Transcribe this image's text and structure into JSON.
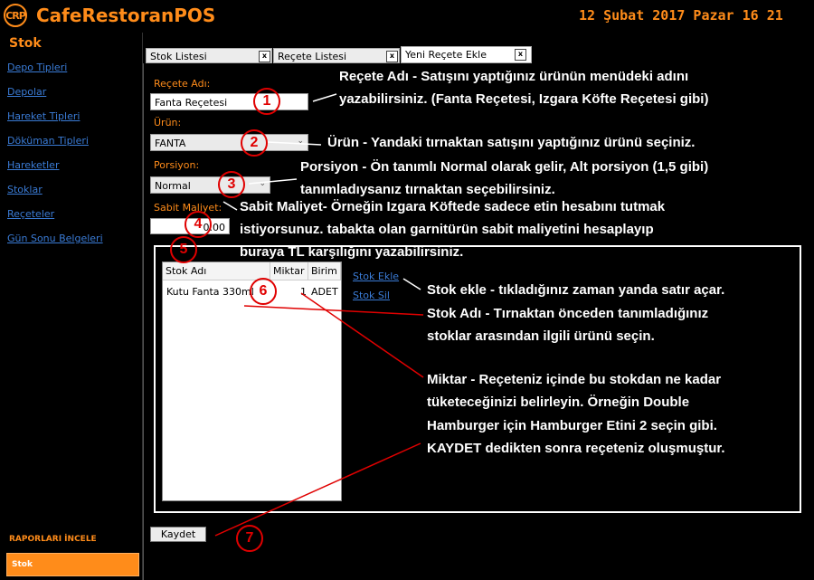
{
  "app": {
    "logo_text": "CRP",
    "name": "CafeRestoranPOS",
    "datetime": "12 Şubat 2017 Pazar 16 21",
    "accent_color": "#ff8c1a"
  },
  "sidebar": {
    "title": "Stok",
    "items": [
      {
        "label": "Depo Tipleri"
      },
      {
        "label": "Depolar"
      },
      {
        "label": "Hareket Tipleri"
      },
      {
        "label": "Döküman Tipleri"
      },
      {
        "label": "Hareketler"
      },
      {
        "label": "Stoklar"
      },
      {
        "label": "Reçeteler"
      },
      {
        "label": "Gün Sonu Belgeleri"
      }
    ],
    "reports_label": "RAPORLARI İNCELE",
    "active_button": "Stok"
  },
  "tabs": [
    {
      "label": "Stok Listesi",
      "close": "x"
    },
    {
      "label": "Reçete Listesi",
      "close": "x"
    },
    {
      "label": "Yeni Reçete Ekle",
      "close": "x",
      "active": true
    }
  ],
  "form": {
    "recete_adi_label": "Reçete Adı:",
    "recete_adi_value": "Fanta Reçetesi",
    "urun_label": "Ürün:",
    "urun_value": "FANTA",
    "porsiyon_label": "Porsiyon:",
    "porsiyon_value": "Normal",
    "sabit_maliyet_label": "Sabit Maliyet:",
    "sabit_maliyet_value": "0.00"
  },
  "stock_grid": {
    "columns": [
      "Stok Adı",
      "Miktar",
      "Birim"
    ],
    "rows": [
      {
        "stok_adi": "Kutu Fanta 330ml",
        "miktar": "1",
        "birim": "ADET"
      }
    ]
  },
  "actions": {
    "stok_ekle": "Stok Ekle",
    "stok_sil": "Stok Sil",
    "kaydet": "Kaydet"
  },
  "annotations": {
    "markers": [
      "1",
      "2",
      "3",
      "4",
      "5",
      "6",
      "7"
    ],
    "color": "#e00000",
    "a1_line1": "Reçete Adı - Satışını yaptığınız ürünün menüdeki adını",
    "a1_line2": "yazabilirsiniz. (Fanta Reçetesi, Izgara Köfte Reçetesi gibi)",
    "a2": "Ürün - Yandaki tırnaktan satışını yaptığınız ürünü seçiniz.",
    "a3_line1": "Porsiyon - Ön tanımlı Normal olarak gelir, Alt porsiyon (1,5 gibi)",
    "a3_line2": "tanımladıysanız tırnaktan seçebilirsiniz.",
    "a4_line1": "Sabit Maliyet- Örneğin Izgara Köftede sadece etin hesabını tutmak",
    "a4_line2": "istiyorsunuz. tabakta olan garnitürün sabit maliyetini hesaplayıp",
    "a4_line3": "buraya TL karşılığını yazabilirsiniz.",
    "a5": "Stok ekle - tıkladığınız zaman yanda satır açar.",
    "a6_line1": "Stok Adı - Tırnaktan önceden tanımladığınız",
    "a6_line2": "stoklar arasından ilgili ürünü seçin.",
    "a7_line1": "Miktar - Reçeteniz içinde bu stokdan ne kadar",
    "a7_line2": "tüketeceğinizi belirleyin. Örneğin Double",
    "a7_line3": "Hamburger için Hamburger Etini 2 seçin gibi.",
    "a7_line4": "KAYDET dedikten sonra reçeteniz oluşmuştur."
  }
}
